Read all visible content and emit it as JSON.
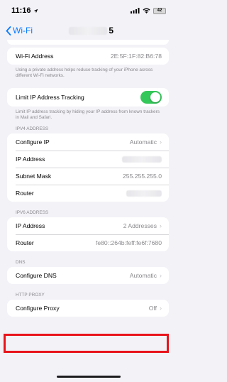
{
  "status_bar": {
    "time": "11:16",
    "battery": "42"
  },
  "nav": {
    "back_label": "Wi-Fi",
    "title_suffix": "5"
  },
  "wifi_address": {
    "label": "Wi-Fi Address",
    "value": "2E:5F:1F:82:B6:78",
    "footer": "Using a private address helps reduce tracking of your iPhone across different Wi-Fi networks."
  },
  "limit_tracking": {
    "label": "Limit IP Address Tracking",
    "enabled": true,
    "footer": "Limit IP address tracking by hiding your IP address from known trackers in Mail and Safari."
  },
  "ipv4": {
    "header": "IPV4 ADDRESS",
    "rows": [
      {
        "label": "Configure IP",
        "value": "Automatic"
      },
      {
        "label": "IP Address",
        "value": ""
      },
      {
        "label": "Subnet Mask",
        "value": "255.255.255.0"
      },
      {
        "label": "Router",
        "value": ""
      }
    ]
  },
  "ipv6": {
    "header": "IPV6 ADDRESS",
    "rows": [
      {
        "label": "IP Address",
        "value": "2 Addresses"
      },
      {
        "label": "Router",
        "value": "fe80::264b:feff:fe6f:7680"
      }
    ]
  },
  "dns": {
    "header": "DNS",
    "configure_label": "Configure DNS",
    "configure_value": "Automatic"
  },
  "proxy": {
    "header": "HTTP PROXY",
    "configure_label": "Configure Proxy",
    "configure_value": "Off"
  },
  "colors": {
    "accent": "#0a7aff",
    "toggle_on": "#34c759",
    "highlight": "#e8141b"
  }
}
